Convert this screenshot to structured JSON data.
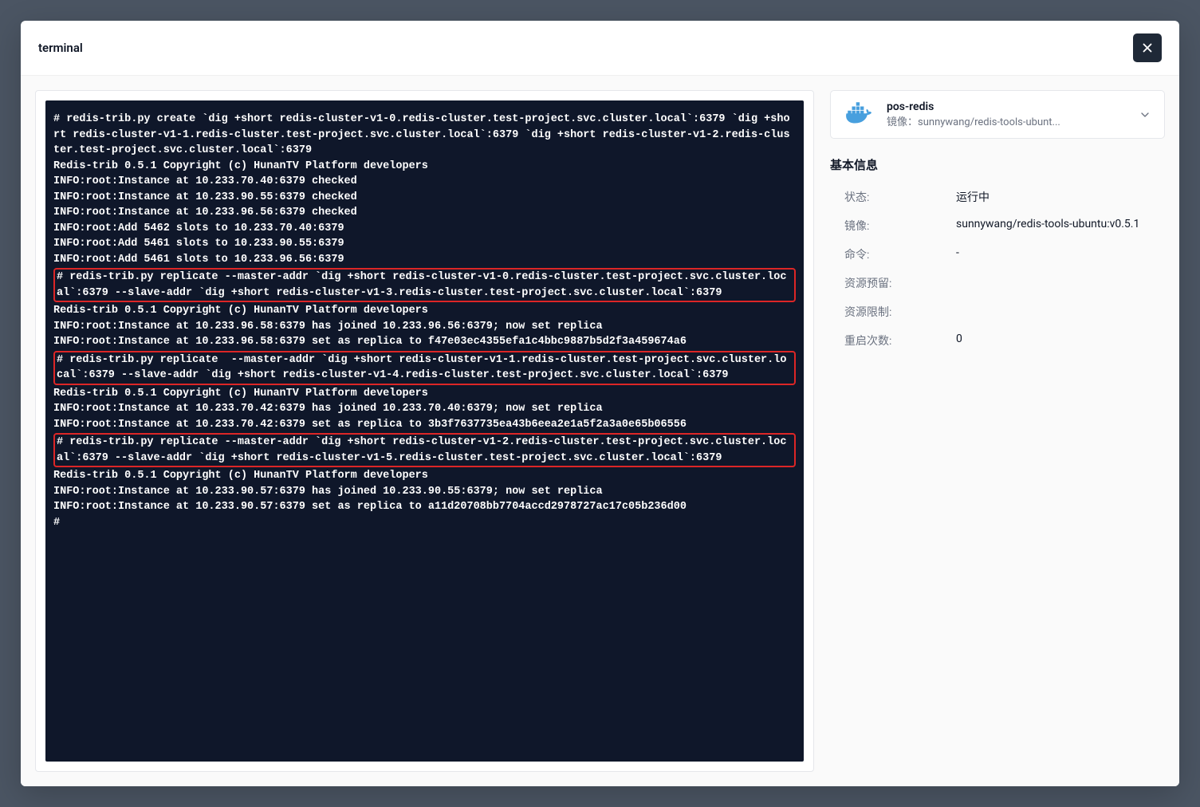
{
  "header": {
    "title": "terminal"
  },
  "terminal": {
    "lines_pre1": "# redis-trib.py create `dig +short redis-cluster-v1-0.redis-cluster.test-project.svc.cluster.local`:6379 `dig +short redis-cluster-v1-1.redis-cluster.test-project.svc.cluster.local`:6379 `dig +short redis-cluster-v1-2.redis-cluster.test-project.svc.cluster.local`:6379\nRedis-trib 0.5.1 Copyright (c) HunanTV Platform developers\nINFO:root:Instance at 10.233.70.40:6379 checked\nINFO:root:Instance at 10.233.90.55:6379 checked\nINFO:root:Instance at 10.233.96.56:6379 checked\nINFO:root:Add 5462 slots to 10.233.70.40:6379\nINFO:root:Add 5461 slots to 10.233.90.55:6379\nINFO:root:Add 5461 slots to 10.233.96.56:6379",
    "box1": "# redis-trib.py replicate --master-addr `dig +short redis-cluster-v1-0.redis-cluster.test-project.svc.cluster.local`:6379 --slave-addr `dig +short redis-cluster-v1-3.redis-cluster.test-project.svc.cluster.local`:6379",
    "lines_mid1": "Redis-trib 0.5.1 Copyright (c) HunanTV Platform developers\nINFO:root:Instance at 10.233.96.58:6379 has joined 10.233.96.56:6379; now set replica\nINFO:root:Instance at 10.233.96.58:6379 set as replica to f47e03ec4355efa1c4bbc9887b5d2f3a459674a6",
    "box2": "# redis-trib.py replicate  --master-addr `dig +short redis-cluster-v1-1.redis-cluster.test-project.svc.cluster.local`:6379 --slave-addr `dig +short redis-cluster-v1-4.redis-cluster.test-project.svc.cluster.local`:6379",
    "lines_mid2": "Redis-trib 0.5.1 Copyright (c) HunanTV Platform developers\nINFO:root:Instance at 10.233.70.42:6379 has joined 10.233.70.40:6379; now set replica\nINFO:root:Instance at 10.233.70.42:6379 set as replica to 3b3f7637735ea43b6eea2e1a5f2a3a0e65b06556",
    "box3": "# redis-trib.py replicate --master-addr `dig +short redis-cluster-v1-2.redis-cluster.test-project.svc.cluster.local`:6379 --slave-addr `dig +short redis-cluster-v1-5.redis-cluster.test-project.svc.cluster.local`:6379",
    "lines_post": "Redis-trib 0.5.1 Copyright (c) HunanTV Platform developers\nINFO:root:Instance at 10.233.90.57:6379 has joined 10.233.90.55:6379; now set replica\nINFO:root:Instance at 10.233.90.57:6379 set as replica to a11d20708bb7704accd2978727ac17c05b236d00\n# "
  },
  "sidebar": {
    "pod": {
      "name": "pos-redis",
      "image_prefix": "镜像：",
      "image": "sunnywang/redis-tools-ubunt..."
    },
    "section_title": "基本信息",
    "rows": {
      "status_label": "状态:",
      "status_value": "运行中",
      "image_label": "镜像:",
      "image_value": "sunnywang/redis-tools-ubuntu:v0.5.1",
      "cmd_label": "命令:",
      "cmd_value": "-",
      "reserve_label": "资源预留:",
      "reserve_value": "",
      "limit_label": "资源限制:",
      "limit_value": "",
      "restart_label": "重启次数:",
      "restart_value": "0"
    }
  }
}
